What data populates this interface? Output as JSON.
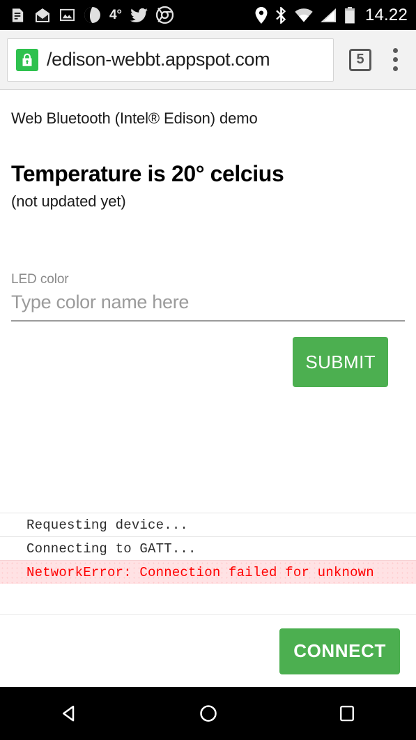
{
  "statusbar": {
    "left_icons": [
      {
        "name": "document-icon"
      },
      {
        "name": "open-envelope-icon"
      },
      {
        "name": "photo-icon"
      },
      {
        "name": "weather-icon"
      }
    ],
    "temperature": "4°",
    "social_icons": [
      {
        "name": "twitter-icon"
      },
      {
        "name": "chrome-icon"
      }
    ],
    "right_icons": [
      {
        "name": "location-pin-icon"
      },
      {
        "name": "bluetooth-icon"
      },
      {
        "name": "wifi-icon"
      },
      {
        "name": "cell-signal-icon"
      },
      {
        "name": "battery-icon"
      }
    ],
    "clock": "14.22"
  },
  "browser": {
    "security_icon": "lock-icon",
    "url": "/edison-webbt.appspot.com",
    "tab_count": "5",
    "menu_icon": "overflow-menu-icon"
  },
  "page": {
    "demo_title": "Web Bluetooth (Intel® Edison) demo",
    "temperature_heading": "Temperature is 20° celcius",
    "temperature_status": "(not updated yet)",
    "led_label": "LED color",
    "led_placeholder": "Type color name here",
    "led_value": "",
    "submit_label": "SUBMIT",
    "connect_label": "CONNECT"
  },
  "log": {
    "lines": [
      {
        "text": "Requesting device...",
        "level": "info"
      },
      {
        "text": "Connecting to GATT...",
        "level": "info"
      },
      {
        "text": "NetworkError: Connection failed for unknown",
        "level": "error"
      }
    ]
  },
  "navbar": {
    "back": "back-button",
    "home": "home-button",
    "recents": "recents-button"
  },
  "colors": {
    "accent_green": "#4caf50",
    "lock_green": "#2ec14e",
    "error_red": "#ff0000",
    "error_bg": "#ffe2e4"
  }
}
